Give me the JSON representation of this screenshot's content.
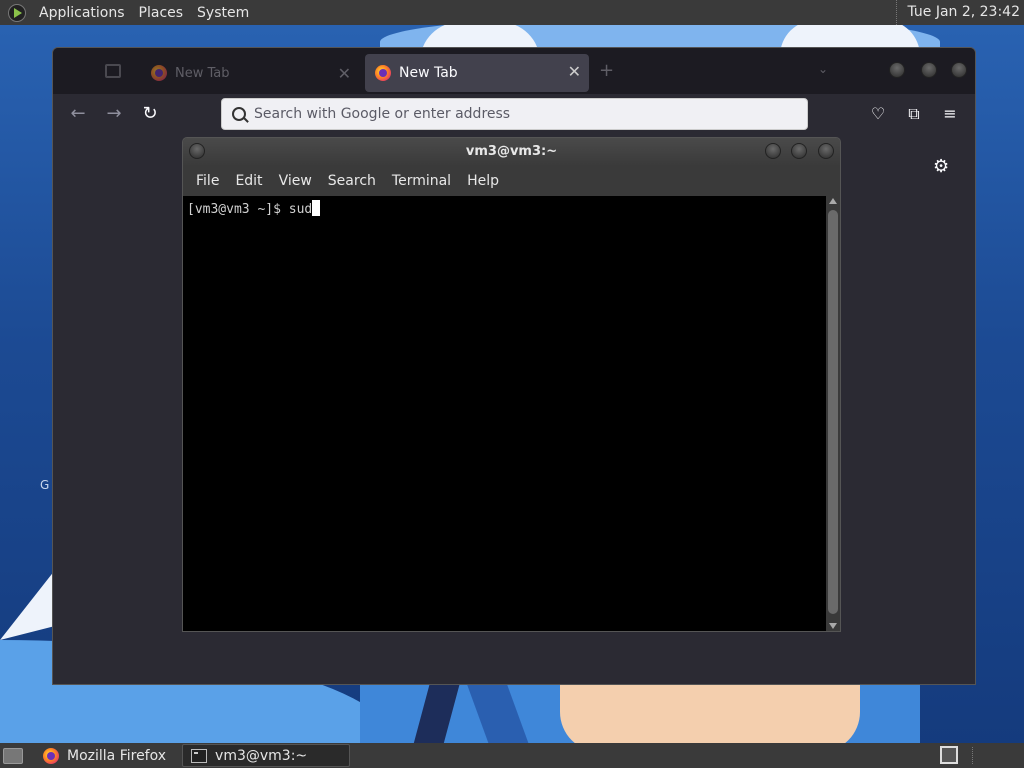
{
  "top_panel": {
    "menus": [
      "Applications",
      "Places",
      "System"
    ],
    "clock": "Tue Jan  2, 23:42"
  },
  "desktop": {
    "partial_label": "G"
  },
  "firefox": {
    "tabs": [
      {
        "label": "New Tab",
        "active": false
      },
      {
        "label": "New Tab",
        "active": true
      }
    ],
    "url_placeholder": "Search with Google or enter address"
  },
  "terminal": {
    "title": "vm3@vm3:~",
    "menus": [
      "File",
      "Edit",
      "View",
      "Search",
      "Terminal",
      "Help"
    ],
    "prompt": "[vm3@vm3 ~]$ ",
    "input": "sud"
  },
  "taskbar": {
    "tasks": [
      {
        "label": "Mozilla Firefox",
        "active": false
      },
      {
        "label": "vm3@vm3:~",
        "active": true
      }
    ]
  },
  "colors": {
    "panel": "#3a3a3a",
    "firefox_bg": "#2b2a33",
    "terminal_bg": "#000000"
  }
}
